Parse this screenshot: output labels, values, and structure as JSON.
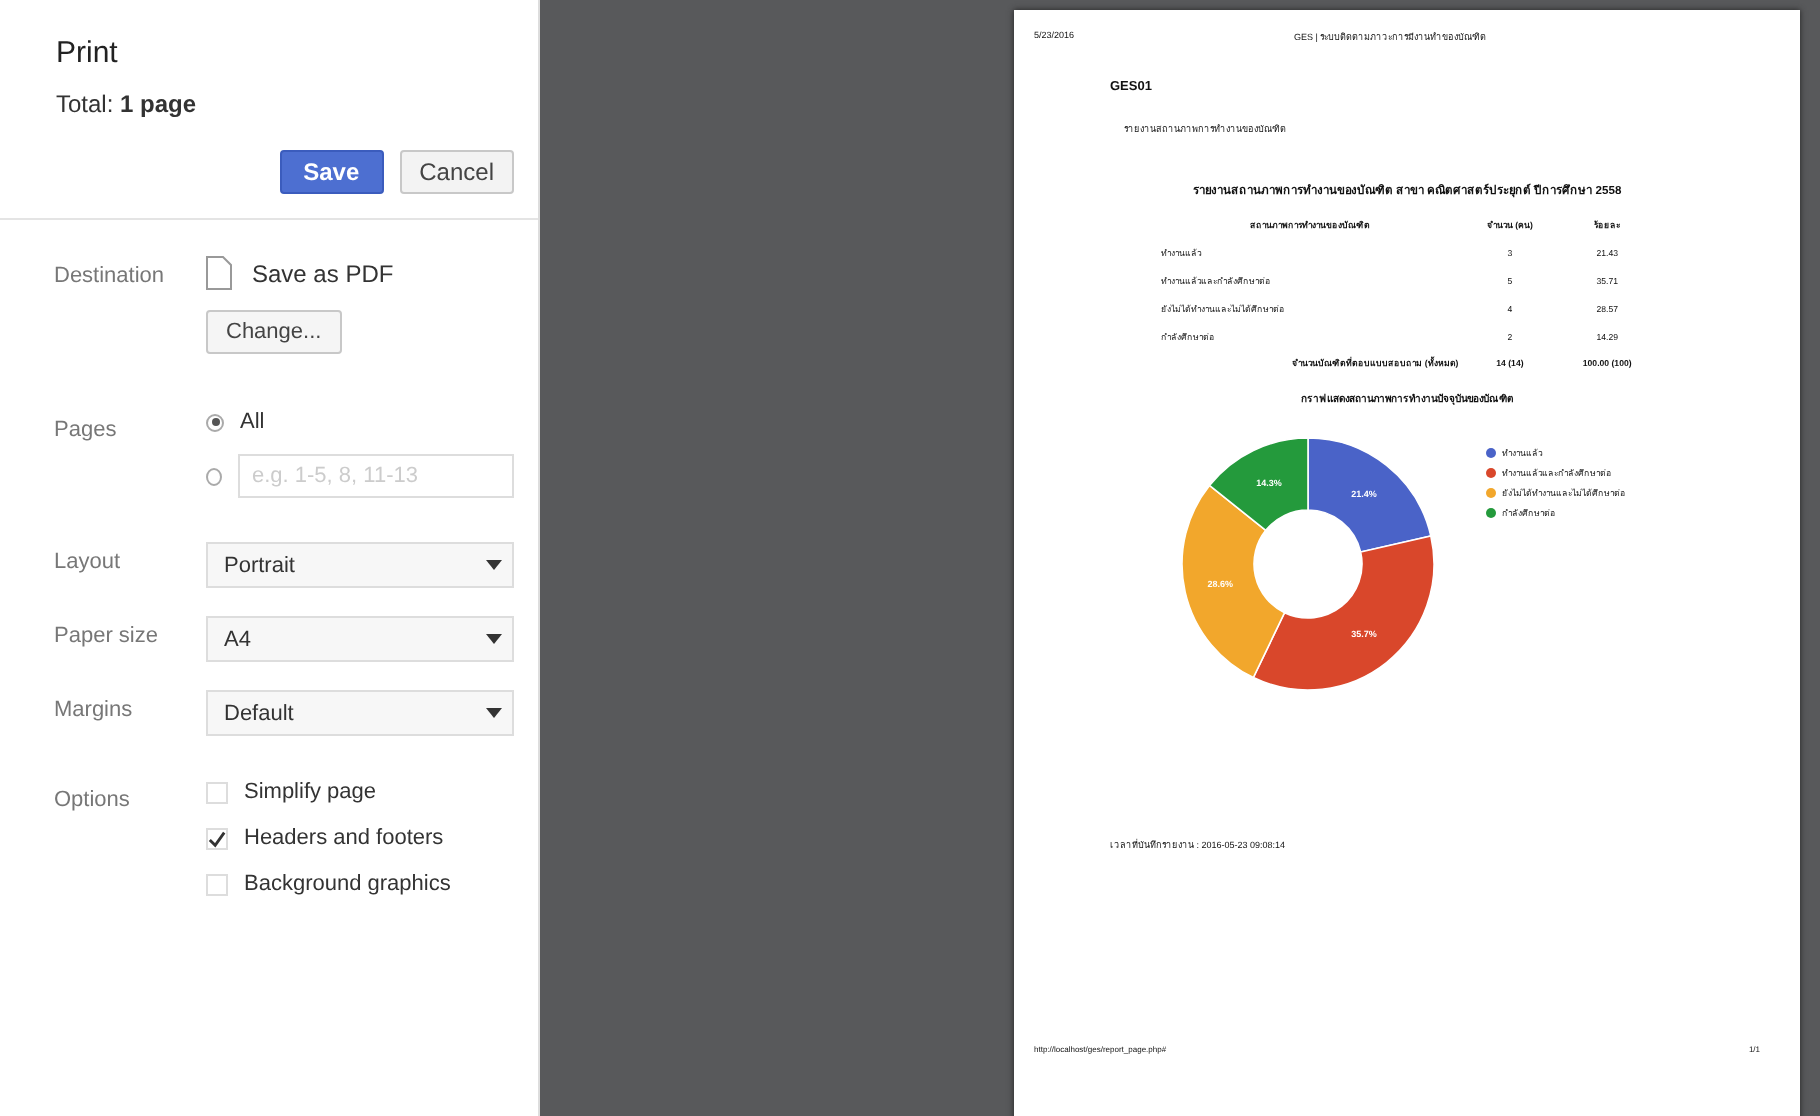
{
  "sidebar": {
    "title": "Print",
    "total": "Total: **1 page**",
    "buttons": [
      {
        "label": "Save",
        "kind": "primary"
      },
      {
        "label": "Cancel",
        "kind": "secondary"
      }
    ],
    "settings": [
      {
        "label": "Destination",
        "kind": "destination",
        "value": "Save as PDF",
        "button": "Change..."
      },
      {
        "label": "Pages",
        "kind": "pages",
        "options": [
          {
            "label": "All",
            "selected": true
          },
          {
            "placeholder": "e.g. 1-5, 8, 11-13",
            "selected": false
          }
        ]
      },
      {
        "label": "Layout",
        "kind": "select",
        "value": "Portrait"
      },
      {
        "label": "Paper size",
        "kind": "select",
        "value": "A4"
      },
      {
        "label": "Margins",
        "kind": "select",
        "value": "Default"
      },
      {
        "label": "Options",
        "kind": "checks",
        "options": [
          {
            "label": "Simplify page",
            "checked": false
          },
          {
            "label": "Headers and footers",
            "checked": true
          },
          {
            "label": "Background graphics",
            "checked": false
          }
        ]
      }
    ]
  },
  "preview": {
    "header_left": "5/23/2016",
    "header_center": "GES | ระบบติดตามภาวะการมีงานทำของบัณฑิต",
    "code": "GES01",
    "subtitle": "รายงานสถานภาพการทำงานของบัณฑิต",
    "report_title": "รายงานสถานภาพการทำงานของบัณฑิต สาขา คณิตศาสตร์ประยุกต์ ปีการศึกษา 2558",
    "table": {
      "columns": [
        "สถานภาพการทำงานของบัณฑิต",
        "จำนวน (คน)",
        "ร้อยละ"
      ],
      "rows": [
        [
          "ทำงานแล้ว",
          "3",
          "21.43"
        ],
        [
          "ทำงานแล้วและกำลังศึกษาต่อ",
          "5",
          "35.71"
        ],
        [
          "ยังไม่ได้ทำงานและไม่ได้ศึกษาต่อ",
          "4",
          "28.57"
        ],
        [
          "กำลังศึกษาต่อ",
          "2",
          "14.29"
        ]
      ],
      "total": [
        "จำนวนบัณฑิตที่ตอบแบบสอบถาม (ทั้งหมด)",
        "14 (14)",
        "100.00 (100)"
      ]
    },
    "chart_data": {
      "type": "donut",
      "title": "กราฟแสดงสถานภาพการทำงานปัจจุบันของบัณฑิต",
      "categories": [
        "ทำงานแล้ว",
        "ทำงานแล้วและกำลังศึกษาต่อ",
        "ยังไม่ได้ทำงานและไม่ได้ศึกษาต่อ",
        "กำลังศึกษาต่อ"
      ],
      "colors": [
        "#4a63c8",
        "#d9472b",
        "#f2a72c",
        "#249a3c"
      ],
      "values": [
        21.43,
        35.71,
        28.57,
        14.29
      ],
      "value_labels": [
        "21.4%",
        "35.7%",
        "28.6%",
        "14.3%"
      ],
      "legend": "right"
    },
    "saved_time": "เวลาที่บันทึกรายงาน : 2016-05-23 09:08:14",
    "url": "http://localhost/ges/report_page.php#",
    "page_number": "1/1"
  }
}
